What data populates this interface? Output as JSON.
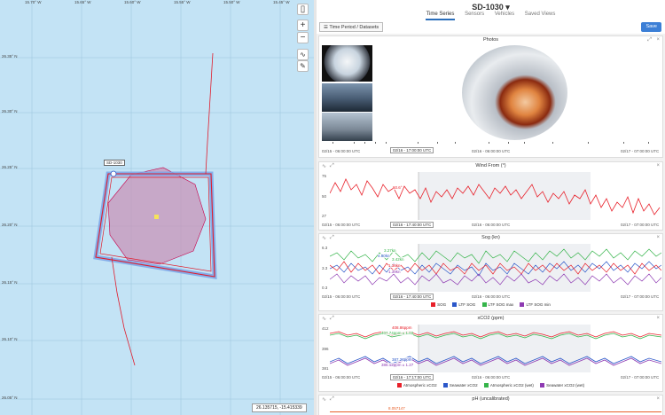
{
  "map": {
    "lon_labels": [
      "15.70° W",
      "15.65° W",
      "15.60° W",
      "15.55° W",
      "15.50° W",
      "15.45° W"
    ],
    "lat_labels": [
      "26.35° N",
      "26.30° N",
      "26.25° N",
      "26.20° N",
      "26.15° N",
      "26.10° N",
      "26.05° N"
    ],
    "vessel_label": "SD-1030",
    "cursor_coords": "26.135715, -15.415339",
    "zoom_in": "+",
    "zoom_out": "−"
  },
  "header": {
    "title": "SD-1030 ▾",
    "tabs": [
      "Time Series",
      "Sensors",
      "Vehicles",
      "Saved Views"
    ],
    "active_tab": "Time Series",
    "time_period_button": "Time Period / Datasets",
    "save_button": "Save"
  },
  "photos": {
    "title": "Photos",
    "t_start": "02/15 - 06:00:00 UTC",
    "t_cursor": "02/16 - 17:00:00 UTC",
    "t_mid": "02/16 - 06:00:00 UTC",
    "t_end": "02/17 - 07:00:00 UTC"
  },
  "wind": {
    "title": "Wind From (°)",
    "y_top": "75",
    "y_mid": "50",
    "y_bottom": "27",
    "cursor_value": "60.6°",
    "t_start": "02/15 - 06:00:00 UTC",
    "t_cursor": "02/16 - 17:40:00 UTC",
    "t_mid": "02/16 - 06:00:00 UTC",
    "t_end": "02/17 - 07:00:00 UTC"
  },
  "sog": {
    "title": "Sog (kn)",
    "y_top": "6.3",
    "y_mid": "3.3",
    "y_bottom": "0.3",
    "values": [
      "3.27kn",
      "4.80kn",
      "3.42kn",
      "1.36kn",
      "1.39kn"
    ],
    "t_start": "02/15 - 06:00:00 UTC",
    "t_cursor": "02/16 - 17:40:00 UTC",
    "t_mid": "02/16 - 06:00:00 UTC",
    "t_end": "02/17 - 07:00:00 UTC",
    "legend": [
      "SOG",
      "LTF SOG",
      "LTF SOG max",
      "LTF SOG min"
    ],
    "colors": [
      "#e8202a",
      "#2b57c9",
      "#35b44a",
      "#8e3ab2"
    ]
  },
  "xco2": {
    "title": "xCO2 (ppm)",
    "y_top": "412",
    "y_mid": "396",
    "y_bottom": "381",
    "upper_values": [
      "408.86ppm",
      "407.74ppm ± 1.03"
    ],
    "lower_values": [
      "387.26ppm",
      "386.12ppm ± 1.27"
    ],
    "t_start": "02/15 - 06:00:00 UTC",
    "t_cursor": "02/16 - 17:17:00 UTC",
    "t_mid": "02/16 - 06:00:00 UTC",
    "t_end": "02/17 - 07:00:00 UTC",
    "legend": [
      "Atmospheric xCO2",
      "Seawater xCO2",
      "Atmospheric xCO2 (wet)",
      "Seawater xCO2 (wet)"
    ],
    "colors": [
      "#e8202a",
      "#2b57c9",
      "#35b44a",
      "#8e3ab2"
    ]
  },
  "ph": {
    "title": "pH (uncalibrated)",
    "value": "8.057147"
  }
}
